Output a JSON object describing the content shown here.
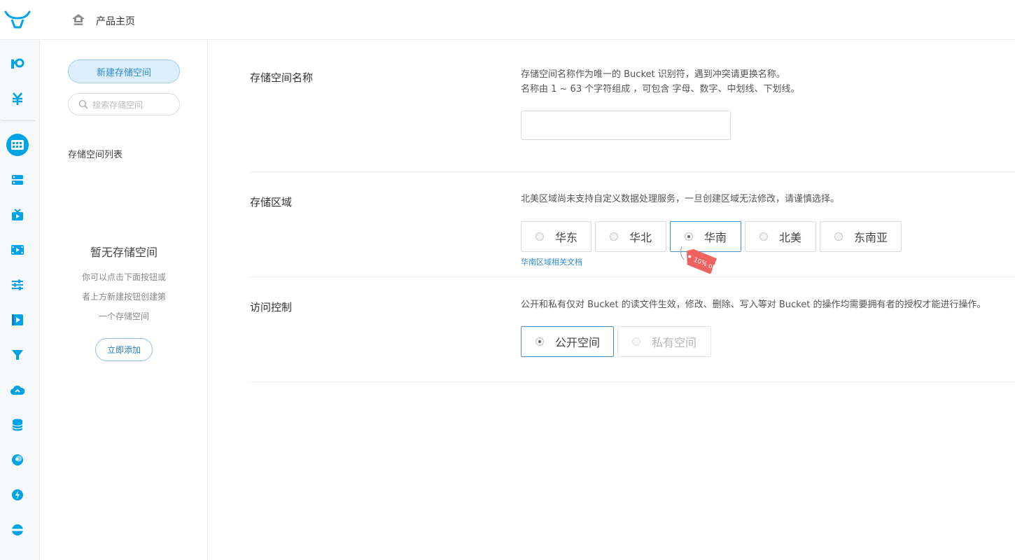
{
  "header": {
    "home_label": "产品主页"
  },
  "sidebar_rail": {
    "icons": [
      "logo-k-icon",
      "yen-icon",
      "bucket-grid-icon",
      "server-list-icon",
      "live-tv-icon",
      "video-film-icon",
      "sliders-icon",
      "player-icon",
      "funnel-icon",
      "cloud-icon",
      "database-icon",
      "moon-icon",
      "lightning-icon",
      "globe-stripe-icon"
    ],
    "accent": "#00a4e4"
  },
  "panel": {
    "new_button": "新建存储空间",
    "search_placeholder": "搜索存储空间",
    "list_title": "存储空间列表",
    "empty_title": "暂无存储空间",
    "empty_lines": [
      "你可以点击下面按钮或",
      "者上方新建按钮创建第",
      "一个存储空间"
    ],
    "add_button": "立即添加"
  },
  "form": {
    "name": {
      "label": "存储空间名称",
      "desc_line1": "存储空间名称作为唯一的 Bucket 识别符，遇到冲突请更换名称。",
      "desc_line2": "名称由 1 ~ 63 个字符组成 ，可包含 字母、数字、中划线、下划线。",
      "value": ""
    },
    "region": {
      "label": "存储区域",
      "desc": "北美区域尚未支持自定义数据处理服务，一旦创建区域无法修改，请谨慎选择。",
      "options": [
        "华东",
        "华北",
        "华南",
        "北美",
        "东南亚"
      ],
      "selected": "华南",
      "doc_link": "华南区域相关文档",
      "promo_tag": "10% off"
    },
    "access": {
      "label": "访问控制",
      "desc": "公开和私有仅对 Bucket 的读文件生效，修改、删除、写入等对 Bucket 的操作均需要拥有者的授权才能进行操作。",
      "options": [
        "公开空间",
        "私有空间"
      ],
      "selected": "公开空间"
    }
  }
}
